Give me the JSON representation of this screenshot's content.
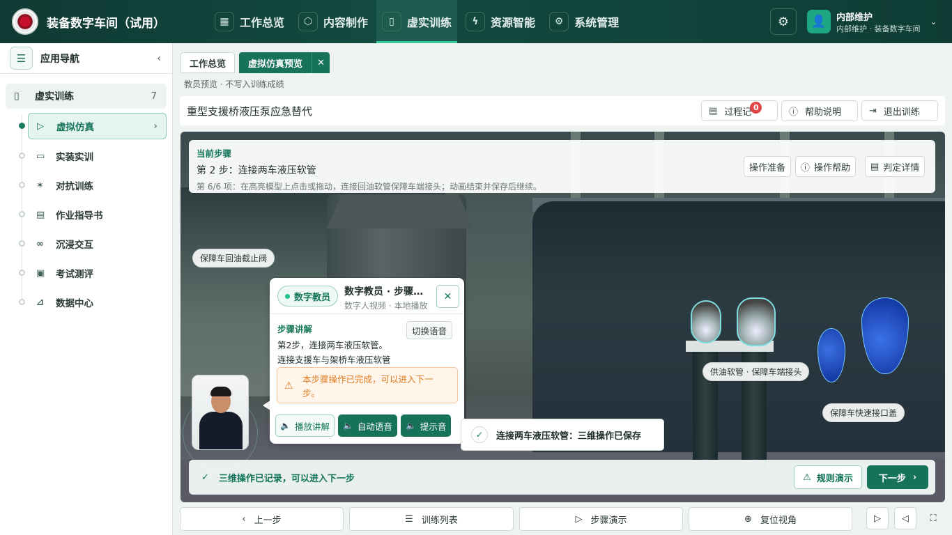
{
  "header": {
    "app_title": "装备数字车间（试用）",
    "nav": [
      {
        "label": "工作总览",
        "icon": "grid-icon"
      },
      {
        "label": "内容制作",
        "icon": "cube-icon"
      },
      {
        "label": "虚实训练",
        "icon": "book-icon"
      },
      {
        "label": "资源智能",
        "icon": "lightning-icon"
      },
      {
        "label": "系统管理",
        "icon": "gear-icon"
      }
    ],
    "active_nav": "虚实训练",
    "user": {
      "name": "内部维护",
      "subtitle": "内部维护 · 装备数字车间"
    }
  },
  "sidebar": {
    "title": "应用导航",
    "group": {
      "label": "虚实训练",
      "count": "7"
    },
    "items": [
      {
        "label": "虚拟仿真",
        "icon": "play-circle-icon"
      },
      {
        "label": "实装实训",
        "icon": "monitor-icon"
      },
      {
        "label": "对抗训练",
        "icon": "figure-icon"
      },
      {
        "label": "作业指导书",
        "icon": "document-icon"
      },
      {
        "label": "沉浸交互",
        "icon": "vr-headset-icon"
      },
      {
        "label": "考试测评",
        "icon": "clipboard-icon"
      },
      {
        "label": "数据中心",
        "icon": "chart-icon"
      }
    ],
    "active_item": "虚拟仿真"
  },
  "tabs": [
    {
      "label": "工作总览"
    },
    {
      "label": "虚拟仿真预览"
    }
  ],
  "preview_note": "教员预览 · 不写入训练成绩",
  "page": {
    "title": "重型支援桥液压泵应急替代",
    "buttons": {
      "log": "过程记",
      "log_badge": "0",
      "help": "帮助说明",
      "exit": "退出训练"
    }
  },
  "step_card": {
    "label": "当前步骤",
    "title": "第 2 步：连接两车液压软管",
    "desc": "第 6/6 项：在高亮模型上点击或拖动，连接回油软管保障车端接头；动画结束并保存后继续。",
    "buttons": {
      "prep": "操作准备",
      "help": "操作帮助",
      "detail": "判定详情"
    }
  },
  "hotspots": {
    "valve": "保障车回油截止阀",
    "hose": "供油软管 · 保障车端接头",
    "cover": "保障车快速接口盖"
  },
  "digital_teacher": {
    "tag": "数字教员",
    "name": "数字教员 · 步骤讲解",
    "subtitle": "数字人视频 · 本地播放",
    "section": "步骤讲解",
    "switch_voice": "切换语音",
    "line1": "第2步，连接两车液压软管。",
    "line2": "连接支援车与架桥车液压软管",
    "warning": "本步骤操作已完成，可以进入下一步。",
    "actions": {
      "play": "播放讲解",
      "auto": "自动语音",
      "tone": "提示音"
    }
  },
  "toast": "连接两车液压软管：三维操作已保存",
  "status": {
    "text": "三维操作已记录，可以进入下一步",
    "rule": "规则演示",
    "next": "下一步"
  },
  "bottom": {
    "prev": "上一步",
    "list": "训练列表",
    "demo": "步骤演示",
    "reset": "复位视角"
  },
  "colors": {
    "brand": "#17725a",
    "header": "#134a40",
    "warning": "#e07a1f",
    "badge": "#e04848"
  }
}
